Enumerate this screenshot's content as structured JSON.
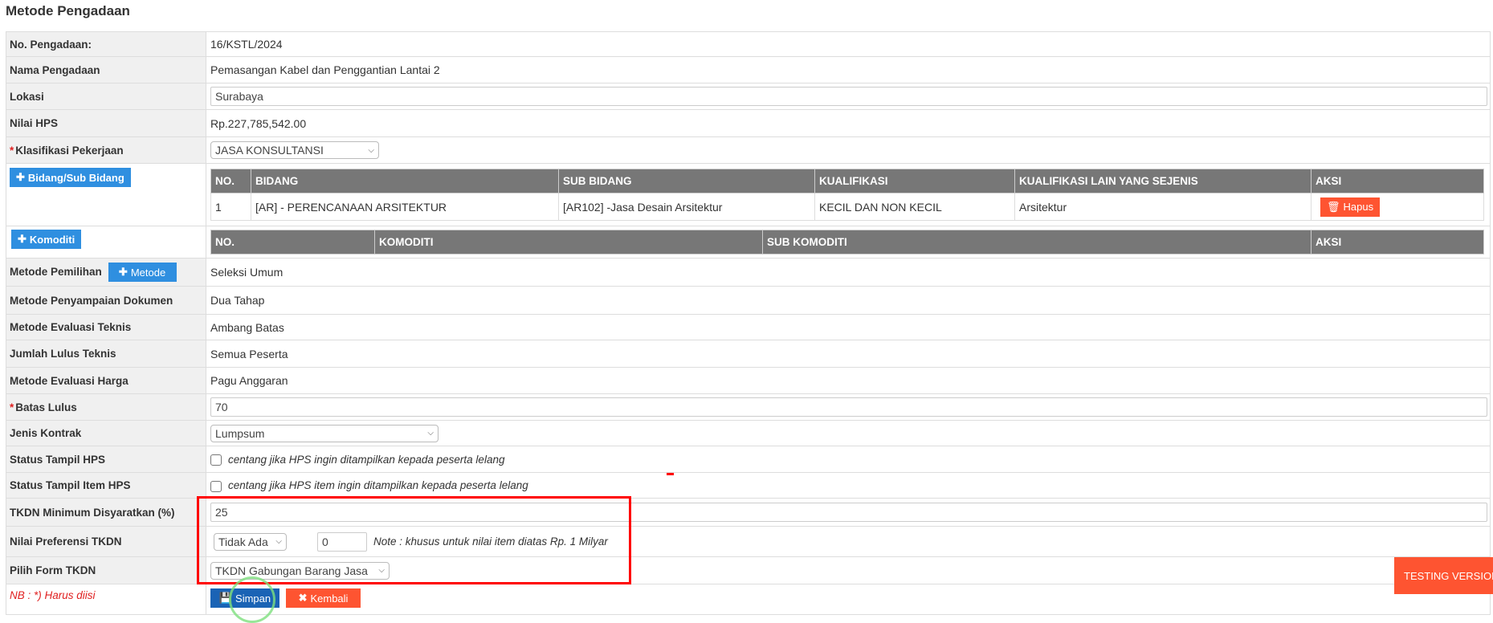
{
  "title": "Metode Pengadaan",
  "rows": {
    "no_pengadaan": {
      "label": "No. Pengadaan:",
      "value": "16/KSTL/2024"
    },
    "nama": {
      "label": "Nama Pengadaan",
      "value": "Pemasangan Kabel dan Penggantian Lantai 2"
    },
    "lokasi": {
      "label": "Lokasi",
      "value": "Surabaya"
    },
    "hps": {
      "label": "Nilai HPS",
      "value": "Rp.227,785,542.00"
    },
    "klasifikasi": {
      "label": "Klasifikasi Pekerjaan",
      "value": "JASA KONSULTANSI"
    },
    "metode_pemilihan": {
      "label": "Metode Pemilihan",
      "button": "Metode",
      "value": "Seleksi Umum"
    },
    "penyampaian": {
      "label": "Metode Penyampaian Dokumen",
      "value": "Dua Tahap"
    },
    "evaluasi_teknis": {
      "label": "Metode Evaluasi Teknis",
      "value": "Ambang Batas"
    },
    "lulus_teknis": {
      "label": "Jumlah Lulus Teknis",
      "value": "Semua Peserta"
    },
    "evaluasi_harga": {
      "label": "Metode Evaluasi Harga",
      "value": "Pagu Anggaran"
    },
    "batas_lulus": {
      "label": "Batas Lulus",
      "value": "70"
    },
    "jenis_kontrak": {
      "label": "Jenis Kontrak",
      "value": "Lumpsum"
    },
    "tampil_hps": {
      "label": "Status Tampil HPS",
      "text": "centang jika HPS ingin ditampilkan kepada peserta lelang",
      "checked": false
    },
    "tampil_item_hps": {
      "label": "Status Tampil Item HPS",
      "text": "centang jika HPS item ingin ditampilkan kepada peserta lelang",
      "checked": false
    },
    "tkdn_min": {
      "label": "TKDN Minimum Disyaratkan (%)",
      "value": "25"
    },
    "preferensi": {
      "label": "Nilai Preferensi TKDN",
      "select": "Tidak Ada",
      "value": "0",
      "note": "Note : khusus untuk nilai item diatas Rp. 1 Milyar"
    },
    "form_tkdn": {
      "label": "Pilih Form TKDN",
      "value": "TKDN Gabungan Barang Jasa"
    }
  },
  "bidang": {
    "button": "Bidang/Sub Bidang",
    "headers": [
      "NO.",
      "BIDANG",
      "SUB BIDANG",
      "KUALIFIKASI",
      "KUALIFIKASI LAIN YANG SEJENIS",
      "AKSI"
    ],
    "rows": [
      {
        "no": "1",
        "bidang": "[AR] - PERENCANAAN ARSITEKTUR",
        "sub": "[AR102] -Jasa Desain Arsitektur",
        "kual": "KECIL DAN NON KECIL",
        "lain": "Arsitektur",
        "aksi": "Hapus"
      }
    ]
  },
  "komoditi": {
    "button": "Komoditi",
    "headers": [
      "NO.",
      "KOMODITI",
      "SUB KOMODITI",
      "AKSI"
    ]
  },
  "footer": {
    "nb": "NB : *) Harus diisi",
    "simpan": "Simpan",
    "kembali": "Kembali"
  },
  "testing": "TESTING VERSION"
}
